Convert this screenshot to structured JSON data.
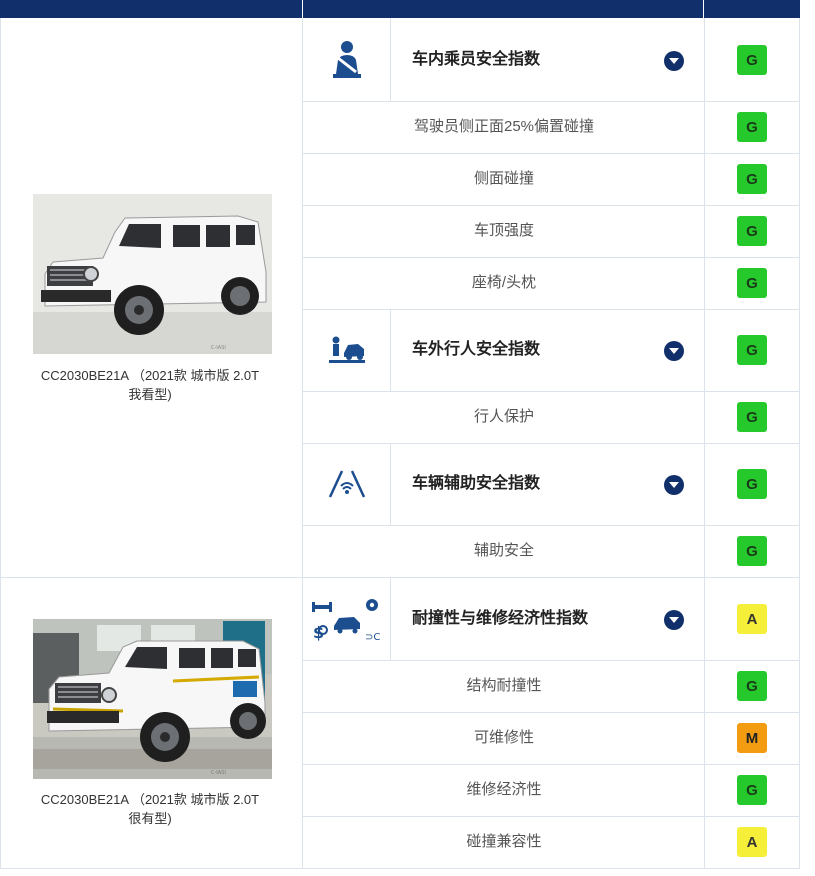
{
  "vehicles": [
    {
      "model_line1": "CC2030BE21A （2021款 城市版 2.0T",
      "model_line2": "我看型)"
    },
    {
      "model_line1": "CC2030BE21A （2021款 城市版 2.0T",
      "model_line2": "很有型)"
    }
  ],
  "categories": [
    {
      "icon": "seatbelt-occupant-icon",
      "title": "车内乘员安全指数",
      "rating": "G"
    },
    {
      "icon": "pedestrian-car-icon",
      "title": "车外行人安全指数",
      "rating": "G"
    },
    {
      "icon": "lane-assist-icon",
      "title": "车辆辅助安全指数",
      "rating": "G"
    },
    {
      "icon": "repair-economy-icon",
      "title": "耐撞性与维修经济性指数",
      "rating": "A"
    }
  ],
  "items": [
    {
      "label": "驾驶员侧正面25%偏置碰撞",
      "rating": "G"
    },
    {
      "label": "侧面碰撞",
      "rating": "G"
    },
    {
      "label": "车顶强度",
      "rating": "G"
    },
    {
      "label": "座椅/头枕",
      "rating": "G"
    },
    {
      "label": "行人保护",
      "rating": "G"
    },
    {
      "label": "辅助安全",
      "rating": "G"
    },
    {
      "label": "结构耐撞性",
      "rating": "G"
    },
    {
      "label": "可维修性",
      "rating": "M"
    },
    {
      "label": "维修经济性",
      "rating": "G"
    },
    {
      "label": "碰撞兼容性",
      "rating": "A"
    }
  ],
  "colors": {
    "header": "#11306b",
    "good": "#25c92b",
    "acceptable": "#f6ef3a",
    "marginal": "#f39c12"
  }
}
